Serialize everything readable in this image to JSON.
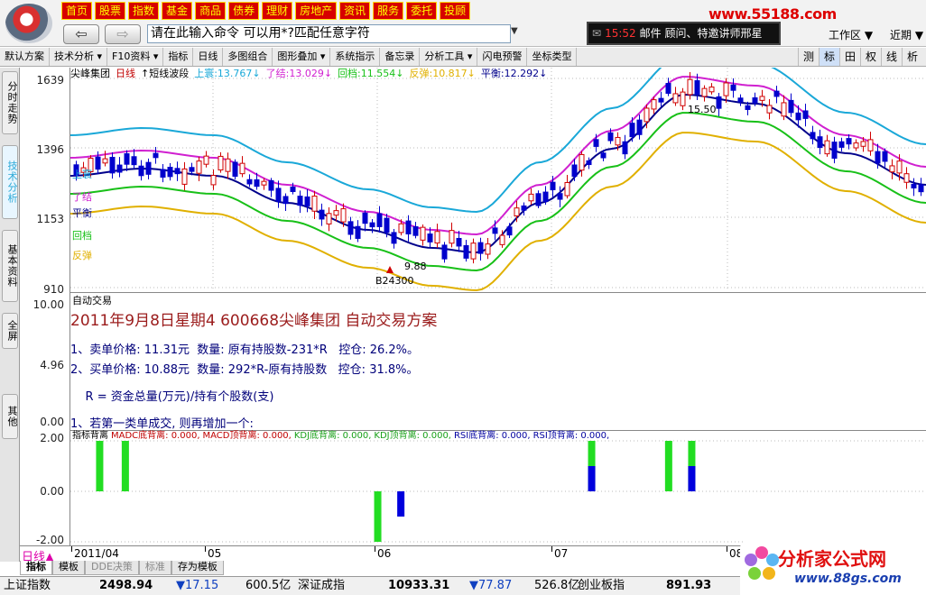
{
  "nav": [
    "首页",
    "股票",
    "指数",
    "基金",
    "商品",
    "债券",
    "理财",
    "房地产",
    "资讯",
    "服务",
    "委托",
    "投顾"
  ],
  "toolbar": {
    "cmd_placeholder": "请在此输入命令   可以用*?匹配任意字符",
    "messages": {
      "time": "15:52",
      "text": "邮件 顾问、特邀讲师邢星"
    },
    "url_watermark": "www.55188.com",
    "workspace": "工作区",
    "period": "近期"
  },
  "tools": [
    "默认方案",
    "技术分析",
    "F10资料",
    "指标",
    "日线",
    "多图组合",
    "图形叠加",
    "系统指示",
    "备忘录",
    "分析工具",
    "闪电预警",
    "坐标类型"
  ],
  "tools_right": [
    "测",
    "标",
    "田",
    "权",
    "线",
    "析"
  ],
  "side_tabs": [
    "分时走势",
    "技术分析",
    "基本资料",
    "全屏",
    "其他"
  ],
  "pane1": {
    "legend": [
      {
        "t": "尖峰集团",
        "c": "#000"
      },
      {
        "t": "日线",
        "c": "#c00000"
      },
      {
        "t": "↑短线波段",
        "c": "#000"
      },
      {
        "t": "上寰:13.767↓",
        "c": "#1aa8d8"
      },
      {
        "t": "了结:13.029↓",
        "c": "#d020d0"
      },
      {
        "t": "回档:11.554↓",
        "c": "#18c018"
      },
      {
        "t": "反弹:10.817↓",
        "c": "#e0b000"
      },
      {
        "t": "平衡:12.292↓",
        "c": "#00008b"
      }
    ],
    "band_labels": [
      {
        "t": "上寰",
        "c": "#1aa8d8"
      },
      {
        "t": "了结",
        "c": "#d020d0"
      },
      {
        "t": "平衡",
        "c": "#00008b"
      },
      {
        "t": "回档",
        "c": "#18c018"
      },
      {
        "t": "反弹",
        "c": "#e0b000"
      }
    ],
    "y_ticks": [
      "1639",
      "1396",
      "1153",
      "910"
    ],
    "high_note": "15.50",
    "low_note": "9.88",
    "buy_note": "B24300"
  },
  "pane2": {
    "title": "自动交易",
    "y_ticks": [
      "10.00",
      "4.96",
      "0.00"
    ],
    "heading": "2011年9月8日星期4 600668尖峰集团 自动交易方案",
    "lines": [
      "1、卖单价格: 11.31元  数量: 原有持股数-231*R   控仓: 26.2%。",
      "2、买单价格: 10.88元  数量: 292*R-原有持股数   控仓: 31.8%。",
      "    R = 资金总量(万元)/持有个股数(支)",
      "1、若第一类单成交, 则再增加一个:"
    ]
  },
  "pane3": {
    "legend": [
      {
        "t": "指标背离",
        "c": "#000"
      },
      {
        "t": "MADC底背离: 0.000,",
        "c": "#c00000"
      },
      {
        "t": "MACD顶背离: 0.000,",
        "c": "#c00000"
      },
      {
        "t": "KDJ底背离: 0.000,",
        "c": "#18a018"
      },
      {
        "t": "KDJ顶背离: 0.000,",
        "c": "#18a018"
      },
      {
        "t": "RSI底背离: 0.000,",
        "c": "#0000a0"
      },
      {
        "t": "RSI顶背离: 0.000,",
        "c": "#0000a0"
      }
    ],
    "y_ticks": [
      "2.00",
      "0.00",
      "-2.00"
    ],
    "bars": [
      {
        "x": 0.03,
        "v": 2,
        "c": "#22dd22"
      },
      {
        "x": 0.06,
        "v": 2,
        "c": "#22dd22"
      },
      {
        "x": 0.355,
        "v": -2,
        "c": "#22dd22"
      },
      {
        "x": 0.382,
        "v": -1,
        "c": "#0000dd"
      },
      {
        "x": 0.605,
        "v": 2,
        "c": "#22dd22"
      },
      {
        "x": 0.605,
        "v": 1,
        "c": "#0000dd"
      },
      {
        "x": 0.695,
        "v": 2,
        "c": "#22dd22"
      },
      {
        "x": 0.722,
        "v": 2,
        "c": "#22dd22"
      },
      {
        "x": 0.722,
        "v": 1,
        "c": "#0000dd"
      }
    ]
  },
  "dates": {
    "label": "日线▲",
    "months": [
      "2011/04",
      "05",
      "06",
      "07",
      "08"
    ]
  },
  "tabs": [
    "指标",
    "模板",
    "DDE决策",
    "标准",
    "存为模板"
  ],
  "status": [
    {
      "name": "上证指数",
      "val": "2498.94",
      "chg": "▼17.15",
      "amt": "600.5亿"
    },
    {
      "name": "深证成指",
      "val": "10933.31",
      "chg": "▼77.87",
      "amt": "526.8亿"
    },
    {
      "name": "创业板指",
      "val": "891.93"
    }
  ],
  "brand": {
    "title": "分析家公式网",
    "url": "www.88gs.com"
  }
}
